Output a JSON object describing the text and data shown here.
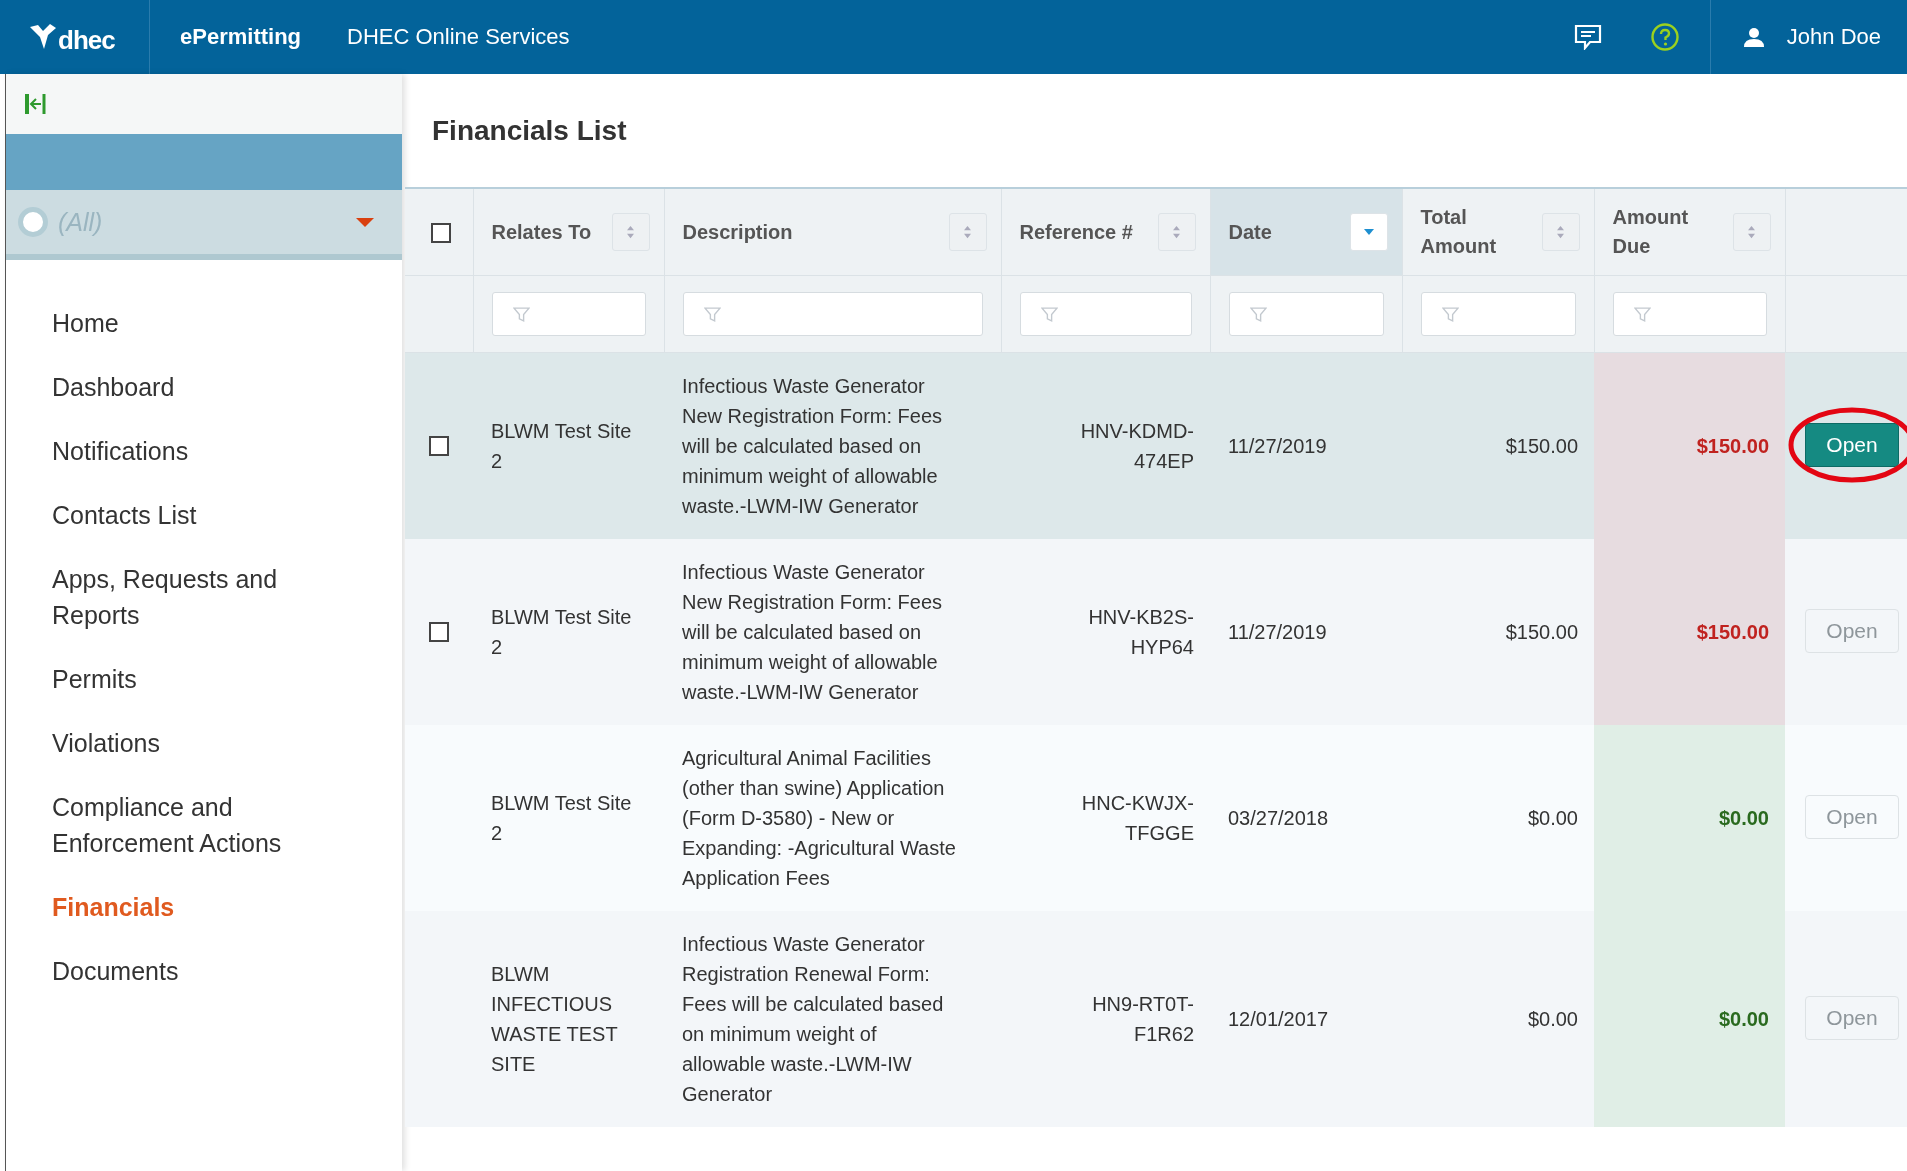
{
  "header": {
    "logo_text": "dhec",
    "app_name": "ePermitting",
    "site_name": "DHEC Online Services",
    "user_name": "John Doe"
  },
  "sidebar": {
    "filter": {
      "value": "(All)"
    },
    "items": [
      {
        "label": "Home",
        "selected": false
      },
      {
        "label": "Dashboard",
        "selected": false
      },
      {
        "label": "Notifications",
        "selected": false
      },
      {
        "label": "Contacts List",
        "selected": false
      },
      {
        "label": "Apps, Requests and Reports",
        "selected": false
      },
      {
        "label": "Permits",
        "selected": false
      },
      {
        "label": "Violations",
        "selected": false
      },
      {
        "label": "Compliance and Enforcement Actions",
        "selected": false
      },
      {
        "label": "Financials",
        "selected": true
      },
      {
        "label": "Documents",
        "selected": false
      }
    ]
  },
  "page_title": "Financials List",
  "table": {
    "select_all_checked": false,
    "columns": [
      {
        "label": "Relates To",
        "sorted": false
      },
      {
        "label": "Description",
        "sorted": false
      },
      {
        "label": "Reference #",
        "sorted": false
      },
      {
        "label": "Date",
        "sorted": true
      },
      {
        "label": "Total Amount",
        "sorted": false
      },
      {
        "label": "Amount Due",
        "sorted": false
      }
    ],
    "rows": [
      {
        "selected": true,
        "checkable": true,
        "checked": false,
        "paid": false,
        "cells": [
          "BLWM Test Site 2",
          "Infectious Waste Generator New Registration Form: Fees will be calculated based on minimum weight of allowable waste.-LWM-IW Generator",
          "HNV-KDMD-474EP",
          "11/27/2019",
          "$150.00",
          "$150.00"
        ],
        "button": {
          "label": "Open",
          "enabled": true,
          "annotated": true
        }
      },
      {
        "selected": false,
        "checkable": true,
        "checked": false,
        "paid": false,
        "cells": [
          "BLWM Test Site 2",
          "Infectious Waste Generator New Registration Form: Fees will be calculated based on minimum weight of allowable waste.-LWM-IW Generator",
          "HNV-KB2S-HYP64",
          "11/27/2019",
          "$150.00",
          "$150.00"
        ],
        "button": {
          "label": "Open",
          "enabled": false,
          "annotated": false
        }
      },
      {
        "selected": false,
        "checkable": false,
        "paid": true,
        "cells": [
          "BLWM Test Site 2",
          "Agricultural Animal Facilities (other than swine) Application (Form D-3580) - New or Expanding: -Agricultural Waste Application Fees",
          "HNC-KWJX-TFGGE",
          "03/27/2018",
          "$0.00",
          "$0.00"
        ],
        "button": {
          "label": "Open",
          "enabled": false,
          "annotated": false
        }
      },
      {
        "selected": false,
        "checkable": false,
        "paid": true,
        "cells": [
          "BLWM INFECTIOUS WASTE TEST SITE",
          "Infectious Waste Generator Registration Renewal Form: Fees will be calculated based on minimum weight of allowable waste.-LWM-IW Generator",
          "HN9-RT0T-F1R62",
          "12/01/2017",
          "$0.00",
          "$0.00"
        ],
        "button": {
          "label": "Open",
          "enabled": false,
          "annotated": false
        }
      }
    ]
  }
}
